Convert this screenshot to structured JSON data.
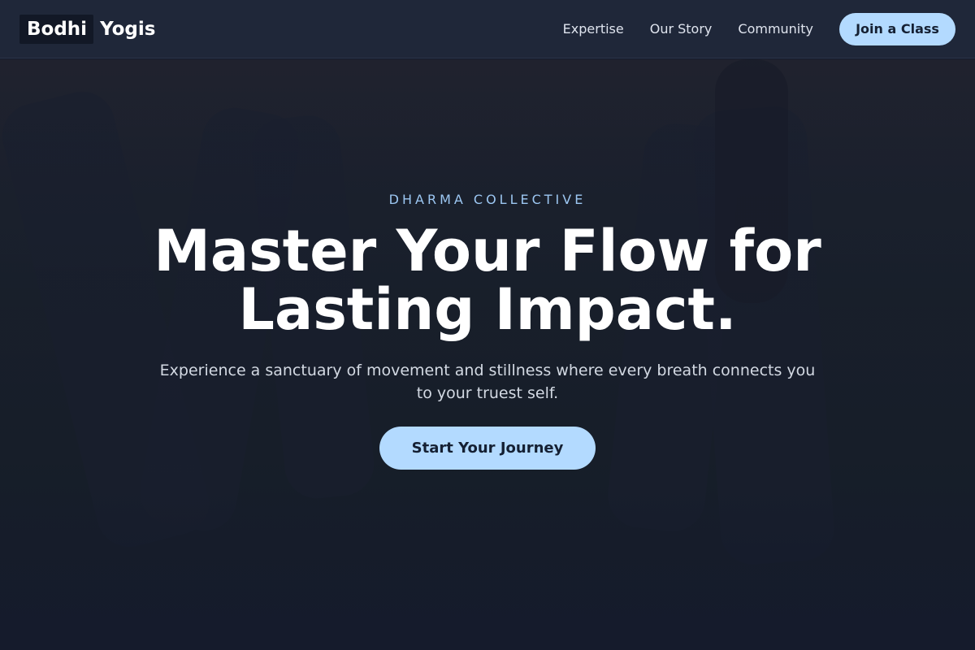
{
  "header": {
    "logo_part_1": "Bodhi",
    "logo_part_2": "Yogis",
    "nav": [
      {
        "label": "Expertise"
      },
      {
        "label": "Our Story"
      },
      {
        "label": "Community"
      }
    ],
    "cta_label": "Join a Class"
  },
  "hero": {
    "eyebrow": "DHARMA COLLECTIVE",
    "headline_line_1": "Master Your Flow for",
    "headline_line_2": "Lasting Impact.",
    "subtext": "Experience a sanctuary of movement and stillness where every breath connects you to your truest self.",
    "cta_label": "Start Your Journey",
    "background_image": "outdoor-yoga-class-photo"
  },
  "colors": {
    "header_bg": "#1f2739",
    "page_bg": "#151b2c",
    "accent": "#b3daff",
    "eyebrow": "#9cc7f2",
    "button_text": "#152033"
  }
}
